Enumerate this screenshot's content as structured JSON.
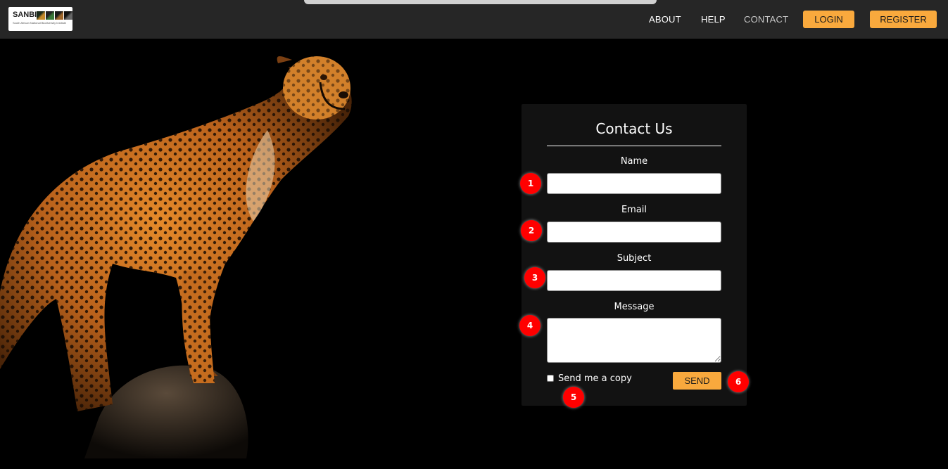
{
  "header": {
    "logo": {
      "brand": "SANBI",
      "subtitle": "South African National Biodiversity Institute"
    },
    "nav": {
      "about": "ABOUT",
      "help": "HELP",
      "contact": "CONTACT"
    },
    "buttons": {
      "login": "LOGIN",
      "register": "REGISTER"
    }
  },
  "hero": {
    "image": "cheetah-photo"
  },
  "contact_form": {
    "title": "Contact Us",
    "name_label": "Name",
    "name_value": "",
    "email_label": "Email",
    "email_value": "",
    "subject_label": "Subject",
    "subject_value": "",
    "message_label": "Message",
    "message_value": "",
    "copy_label": "Send me a copy",
    "copy_checked": false,
    "send_label": "SEND"
  },
  "markers": [
    "1",
    "2",
    "3",
    "4",
    "5",
    "6"
  ],
  "colors": {
    "accent": "#f9a93d",
    "topbar": "#262626",
    "card": "#121212",
    "marker": "#ff0000"
  }
}
